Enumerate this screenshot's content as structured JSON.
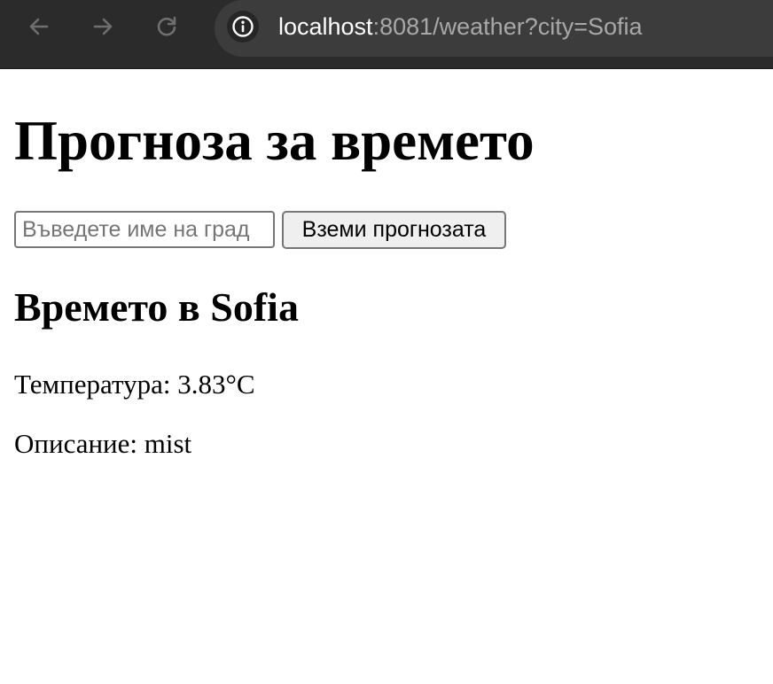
{
  "browser": {
    "url_host": "localhost",
    "url_rest": ":8081/weather?city=Sofia",
    "icons": {
      "back": "arrow-left-icon",
      "forward": "arrow-right-icon",
      "reload": "reload-icon",
      "site_info": "info-icon"
    }
  },
  "page": {
    "title": "Прогноза за времето",
    "search": {
      "placeholder": "Въведете име на град",
      "value": ""
    },
    "submit_label": "Вземи прогнозата",
    "result": {
      "heading": "Времето в Sofia",
      "temperature": "Температура: 3.83°C",
      "description": "Описание: mist"
    }
  },
  "colors": {
    "toolbar_bg": "#2b2b2b",
    "omnibox_bg": "#3c3c3c",
    "url_host": "#ffffff",
    "url_rest": "#a8a8a8",
    "button_bg": "#efefef"
  }
}
